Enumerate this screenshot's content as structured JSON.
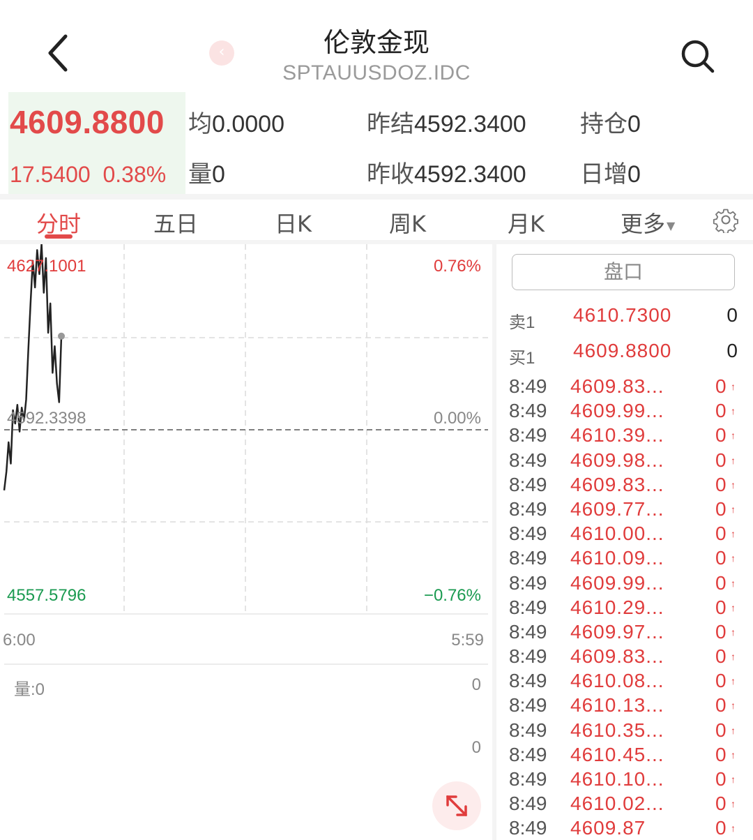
{
  "header": {
    "title": "伦敦金现",
    "subtitle": "SPTAUUSDOZ.IDC",
    "mini_back_glyph": "‹"
  },
  "quote": {
    "price": "4609.8800",
    "change": "17.5400",
    "change_pct": "0.38%",
    "avg_label": "均",
    "avg_value": "0.0000",
    "prev_settle_label": "昨结",
    "prev_settle_value": "4592.3400",
    "open_interest_label": "持仓",
    "open_interest_value": "0",
    "volume_label": "量",
    "volume_value": "0",
    "prev_close_label": "昨收",
    "prev_close_value": "4592.3400",
    "daily_increase_label": "日增",
    "daily_increase_value": "0"
  },
  "tabs": {
    "items": [
      "分时",
      "五日",
      "日K",
      "周K",
      "月K"
    ],
    "more_label": "更多",
    "active_index": 0
  },
  "chart": {
    "high_price": "4627.1001",
    "high_pct": "0.76%",
    "mid_price": "4592.3398",
    "mid_pct": "0.00%",
    "low_price": "4557.5796",
    "low_pct": "−0.76%",
    "time_start": "6:00",
    "time_end": "5:59",
    "volume_label": "量:0",
    "volume_axis_top": "0",
    "volume_axis_bottom": "0"
  },
  "chart_data": {
    "type": "line",
    "title": "",
    "ylim": [
      4557.5796,
      4627.1001
    ],
    "reference": 4592.3398,
    "series": [
      {
        "values": [
          4581.0,
          4584.5,
          4590.0,
          4586.0,
          4596.0,
          4593.5,
          4597.0,
          4592.0,
          4596.5,
          4594.0,
          4598.0,
          4607.5,
          4616.0,
          4624.0,
          4619.0,
          4626.0,
          4621.5,
          4627.1,
          4618.0,
          4624.5,
          4610.5,
          4616.0,
          4603.0,
          4608.0,
          4601.0,
          4597.5,
          4609.88
        ]
      }
    ]
  },
  "panel": {
    "pankou_label": "盘口",
    "sell1_label": "卖1",
    "sell1_price": "4610.7300",
    "sell1_vol": "0",
    "buy1_label": "买1",
    "buy1_price": "4609.8800",
    "buy1_vol": "0",
    "ticks": [
      {
        "time": "8:49",
        "price": "4609.83...",
        "vol": "0"
      },
      {
        "time": "8:49",
        "price": "4609.99...",
        "vol": "0"
      },
      {
        "time": "8:49",
        "price": "4610.39...",
        "vol": "0"
      },
      {
        "time": "8:49",
        "price": "4609.98...",
        "vol": "0"
      },
      {
        "time": "8:49",
        "price": "4609.83...",
        "vol": "0"
      },
      {
        "time": "8:49",
        "price": "4609.77...",
        "vol": "0"
      },
      {
        "time": "8:49",
        "price": "4610.00...",
        "vol": "0"
      },
      {
        "time": "8:49",
        "price": "4610.09...",
        "vol": "0"
      },
      {
        "time": "8:49",
        "price": "4609.99...",
        "vol": "0"
      },
      {
        "time": "8:49",
        "price": "4610.29...",
        "vol": "0"
      },
      {
        "time": "8:49",
        "price": "4609.97...",
        "vol": "0"
      },
      {
        "time": "8:49",
        "price": "4609.83...",
        "vol": "0"
      },
      {
        "time": "8:49",
        "price": "4610.08...",
        "vol": "0"
      },
      {
        "time": "8:49",
        "price": "4610.13...",
        "vol": "0"
      },
      {
        "time": "8:49",
        "price": "4610.35...",
        "vol": "0"
      },
      {
        "time": "8:49",
        "price": "4610.45...",
        "vol": "0"
      },
      {
        "time": "8:49",
        "price": "4610.10...",
        "vol": "0"
      },
      {
        "time": "8:49",
        "price": "4610.02...",
        "vol": "0"
      },
      {
        "time": "8:49",
        "price": "4609.87",
        "vol": "0"
      }
    ]
  },
  "colors": {
    "up": "#e03c3c",
    "down": "#1a9a50",
    "line": "#222222"
  }
}
